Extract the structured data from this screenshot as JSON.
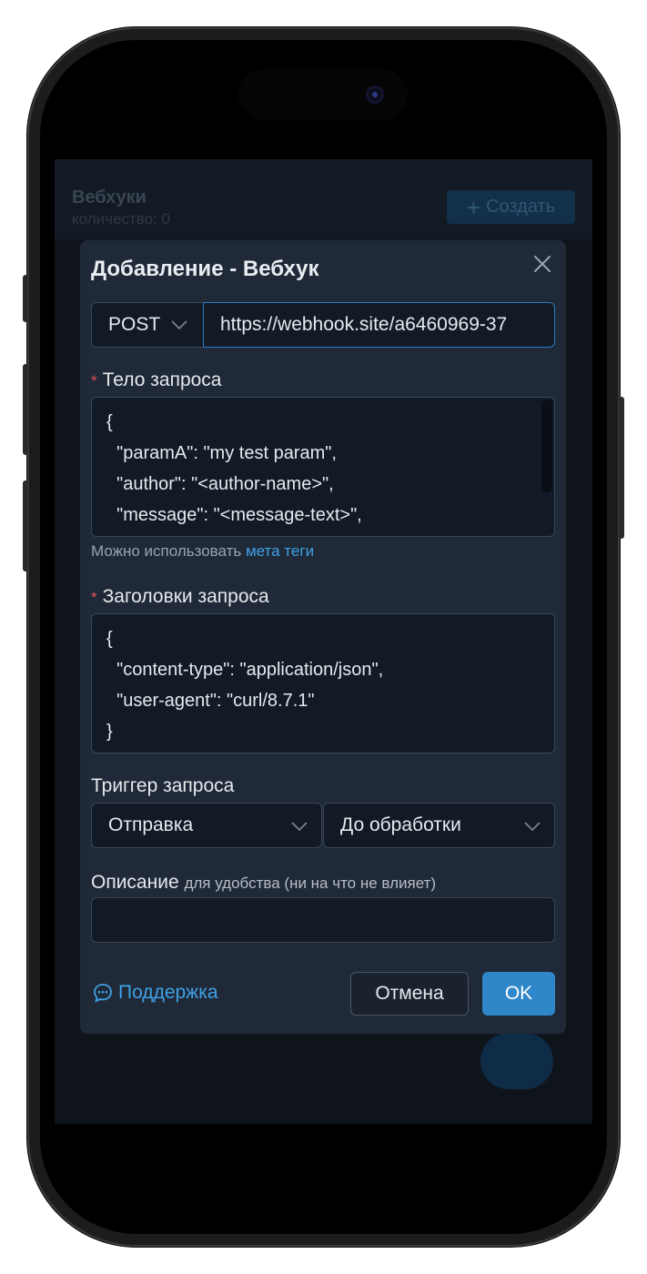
{
  "app": {
    "title": "Вебхуки",
    "count": "количество: 0",
    "create_button": "Создать"
  },
  "dialog": {
    "title": "Добавление - Вебхук",
    "method": "POST",
    "url": "https://webhook.site/a6460969-37",
    "body_label": "Тело запроса",
    "body_lines": [
      "{",
      "  \"paramA\": \"my test param\",",
      "  \"author\": \"<author-name>\",",
      "  \"message\": \"<message-text>\","
    ],
    "hint_text": "Можно использовать",
    "hint_link": "мета теги",
    "headers_label": "Заголовки запроса",
    "headers_lines": [
      "{",
      "  \"content-type\": \"application/json\",",
      "  \"user-agent\": \"curl/8.7.1\"",
      "}"
    ],
    "trigger_label": "Триггер запроса",
    "trigger_event": "Отправка",
    "trigger_timing": "До обработки",
    "description_label": "Описание",
    "description_note": "для удобства (ни на что не влияет)",
    "description_value": "",
    "support_label": "Поддержка",
    "cancel_label": "Отмена",
    "ok_label": "OK"
  },
  "colors": {
    "dialog_bg": "#1f2937",
    "accent": "#2f86c8",
    "link": "#3ea1e6",
    "required": "#e35353"
  }
}
